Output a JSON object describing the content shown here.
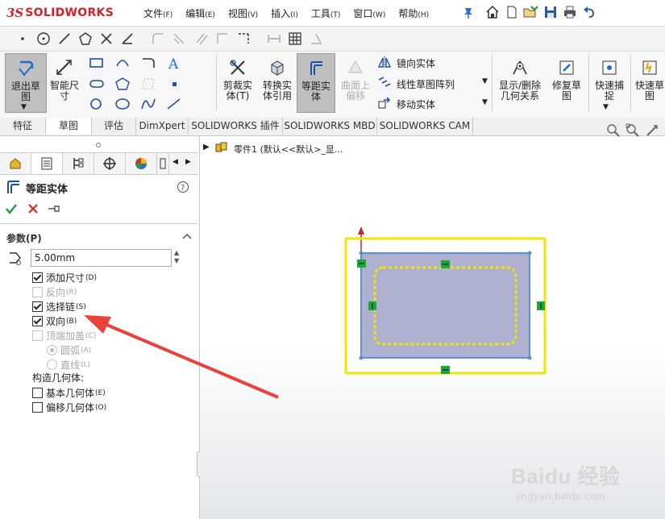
{
  "app": {
    "logo_ds": "3S",
    "logo_text": "SOLIDWORKS"
  },
  "menu": [
    {
      "label": "文件",
      "key": "(F)"
    },
    {
      "label": "编辑",
      "key": "(E)"
    },
    {
      "label": "视图",
      "key": "(V)"
    },
    {
      "label": "插入",
      "key": "(I)"
    },
    {
      "label": "工具",
      "key": "(T)"
    },
    {
      "label": "窗口",
      "key": "(W)"
    },
    {
      "label": "帮助",
      "key": "(H)"
    }
  ],
  "commands": {
    "exit_sketch": "退出草图",
    "smart_dim": "智能尺寸",
    "trim": "剪裁实体(T)",
    "convert": "转换实体引用",
    "offset": "等距实体",
    "surface_offset": "曲面上偏移",
    "mirror": "镜向实体",
    "linear_pattern": "线性草图阵列",
    "move": "移动实体",
    "display_relations": "显示/删除几何关系",
    "repair": "修复草图",
    "quick_snap": "快速捕捉",
    "rapid_sketch": "快速草图"
  },
  "tabs": [
    "特征",
    "草图",
    "评估",
    "DimXpert",
    "SOLIDWORKS 插件",
    "SOLIDWORKS MBD",
    "SOLIDWORKS CAM"
  ],
  "selected_tab": "草图",
  "property_manager": {
    "title": "等距实体",
    "section": "参数(P)",
    "distance_value": "5.00mm",
    "options": [
      {
        "label": "添加尺寸",
        "key": "(D)",
        "checked": true,
        "disabled": false
      },
      {
        "label": "反向",
        "key": "(R)",
        "checked": false,
        "disabled": true
      },
      {
        "label": "选择链",
        "key": "(S)",
        "checked": true,
        "disabled": false
      },
      {
        "label": "双向",
        "key": "(B)",
        "checked": true,
        "disabled": false
      },
      {
        "label": "顶端加盖",
        "key": "(C)",
        "checked": false,
        "disabled": true
      }
    ],
    "cap_options": [
      {
        "label": "圆弧",
        "key": "(A)",
        "selected": true
      },
      {
        "label": "直线",
        "key": "(L)",
        "selected": false
      }
    ],
    "construction_label": "构造几何体:",
    "construction": [
      {
        "label": "基本几何体",
        "key": "(E)",
        "checked": false
      },
      {
        "label": "偏移几何体",
        "key": "(O)",
        "checked": false
      }
    ]
  },
  "tree": {
    "label": "零件1  (默认<<默认>_显..."
  },
  "watermark": {
    "brand": "Baidu 经验",
    "url": "jingyan.baidu.com"
  },
  "colors": {
    "accent_red": "#d2232a",
    "selection_blue": "#5b8fd6",
    "offset_yellow": "#f2e600",
    "arrow_red": "#e8423a",
    "fill": "#aeb0cf",
    "handle_green": "#19a83a"
  }
}
